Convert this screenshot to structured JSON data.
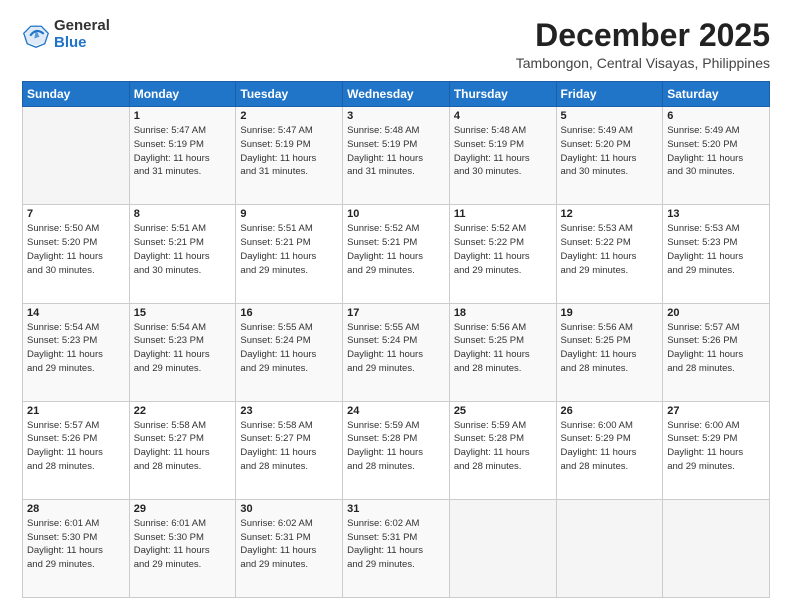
{
  "logo": {
    "general": "General",
    "blue": "Blue"
  },
  "title": "December 2025",
  "subtitle": "Tambongon, Central Visayas, Philippines",
  "days_header": [
    "Sunday",
    "Monday",
    "Tuesday",
    "Wednesday",
    "Thursday",
    "Friday",
    "Saturday"
  ],
  "weeks": [
    [
      {
        "num": "",
        "info": ""
      },
      {
        "num": "1",
        "info": "Sunrise: 5:47 AM\nSunset: 5:19 PM\nDaylight: 11 hours\nand 31 minutes."
      },
      {
        "num": "2",
        "info": "Sunrise: 5:47 AM\nSunset: 5:19 PM\nDaylight: 11 hours\nand 31 minutes."
      },
      {
        "num": "3",
        "info": "Sunrise: 5:48 AM\nSunset: 5:19 PM\nDaylight: 11 hours\nand 31 minutes."
      },
      {
        "num": "4",
        "info": "Sunrise: 5:48 AM\nSunset: 5:19 PM\nDaylight: 11 hours\nand 30 minutes."
      },
      {
        "num": "5",
        "info": "Sunrise: 5:49 AM\nSunset: 5:20 PM\nDaylight: 11 hours\nand 30 minutes."
      },
      {
        "num": "6",
        "info": "Sunrise: 5:49 AM\nSunset: 5:20 PM\nDaylight: 11 hours\nand 30 minutes."
      }
    ],
    [
      {
        "num": "7",
        "info": "Sunrise: 5:50 AM\nSunset: 5:20 PM\nDaylight: 11 hours\nand 30 minutes."
      },
      {
        "num": "8",
        "info": "Sunrise: 5:51 AM\nSunset: 5:21 PM\nDaylight: 11 hours\nand 30 minutes."
      },
      {
        "num": "9",
        "info": "Sunrise: 5:51 AM\nSunset: 5:21 PM\nDaylight: 11 hours\nand 29 minutes."
      },
      {
        "num": "10",
        "info": "Sunrise: 5:52 AM\nSunset: 5:21 PM\nDaylight: 11 hours\nand 29 minutes."
      },
      {
        "num": "11",
        "info": "Sunrise: 5:52 AM\nSunset: 5:22 PM\nDaylight: 11 hours\nand 29 minutes."
      },
      {
        "num": "12",
        "info": "Sunrise: 5:53 AM\nSunset: 5:22 PM\nDaylight: 11 hours\nand 29 minutes."
      },
      {
        "num": "13",
        "info": "Sunrise: 5:53 AM\nSunset: 5:23 PM\nDaylight: 11 hours\nand 29 minutes."
      }
    ],
    [
      {
        "num": "14",
        "info": "Sunrise: 5:54 AM\nSunset: 5:23 PM\nDaylight: 11 hours\nand 29 minutes."
      },
      {
        "num": "15",
        "info": "Sunrise: 5:54 AM\nSunset: 5:23 PM\nDaylight: 11 hours\nand 29 minutes."
      },
      {
        "num": "16",
        "info": "Sunrise: 5:55 AM\nSunset: 5:24 PM\nDaylight: 11 hours\nand 29 minutes."
      },
      {
        "num": "17",
        "info": "Sunrise: 5:55 AM\nSunset: 5:24 PM\nDaylight: 11 hours\nand 29 minutes."
      },
      {
        "num": "18",
        "info": "Sunrise: 5:56 AM\nSunset: 5:25 PM\nDaylight: 11 hours\nand 28 minutes."
      },
      {
        "num": "19",
        "info": "Sunrise: 5:56 AM\nSunset: 5:25 PM\nDaylight: 11 hours\nand 28 minutes."
      },
      {
        "num": "20",
        "info": "Sunrise: 5:57 AM\nSunset: 5:26 PM\nDaylight: 11 hours\nand 28 minutes."
      }
    ],
    [
      {
        "num": "21",
        "info": "Sunrise: 5:57 AM\nSunset: 5:26 PM\nDaylight: 11 hours\nand 28 minutes."
      },
      {
        "num": "22",
        "info": "Sunrise: 5:58 AM\nSunset: 5:27 PM\nDaylight: 11 hours\nand 28 minutes."
      },
      {
        "num": "23",
        "info": "Sunrise: 5:58 AM\nSunset: 5:27 PM\nDaylight: 11 hours\nand 28 minutes."
      },
      {
        "num": "24",
        "info": "Sunrise: 5:59 AM\nSunset: 5:28 PM\nDaylight: 11 hours\nand 28 minutes."
      },
      {
        "num": "25",
        "info": "Sunrise: 5:59 AM\nSunset: 5:28 PM\nDaylight: 11 hours\nand 28 minutes."
      },
      {
        "num": "26",
        "info": "Sunrise: 6:00 AM\nSunset: 5:29 PM\nDaylight: 11 hours\nand 28 minutes."
      },
      {
        "num": "27",
        "info": "Sunrise: 6:00 AM\nSunset: 5:29 PM\nDaylight: 11 hours\nand 29 minutes."
      }
    ],
    [
      {
        "num": "28",
        "info": "Sunrise: 6:01 AM\nSunset: 5:30 PM\nDaylight: 11 hours\nand 29 minutes."
      },
      {
        "num": "29",
        "info": "Sunrise: 6:01 AM\nSunset: 5:30 PM\nDaylight: 11 hours\nand 29 minutes."
      },
      {
        "num": "30",
        "info": "Sunrise: 6:02 AM\nSunset: 5:31 PM\nDaylight: 11 hours\nand 29 minutes."
      },
      {
        "num": "31",
        "info": "Sunrise: 6:02 AM\nSunset: 5:31 PM\nDaylight: 11 hours\nand 29 minutes."
      },
      {
        "num": "",
        "info": ""
      },
      {
        "num": "",
        "info": ""
      },
      {
        "num": "",
        "info": ""
      }
    ]
  ]
}
